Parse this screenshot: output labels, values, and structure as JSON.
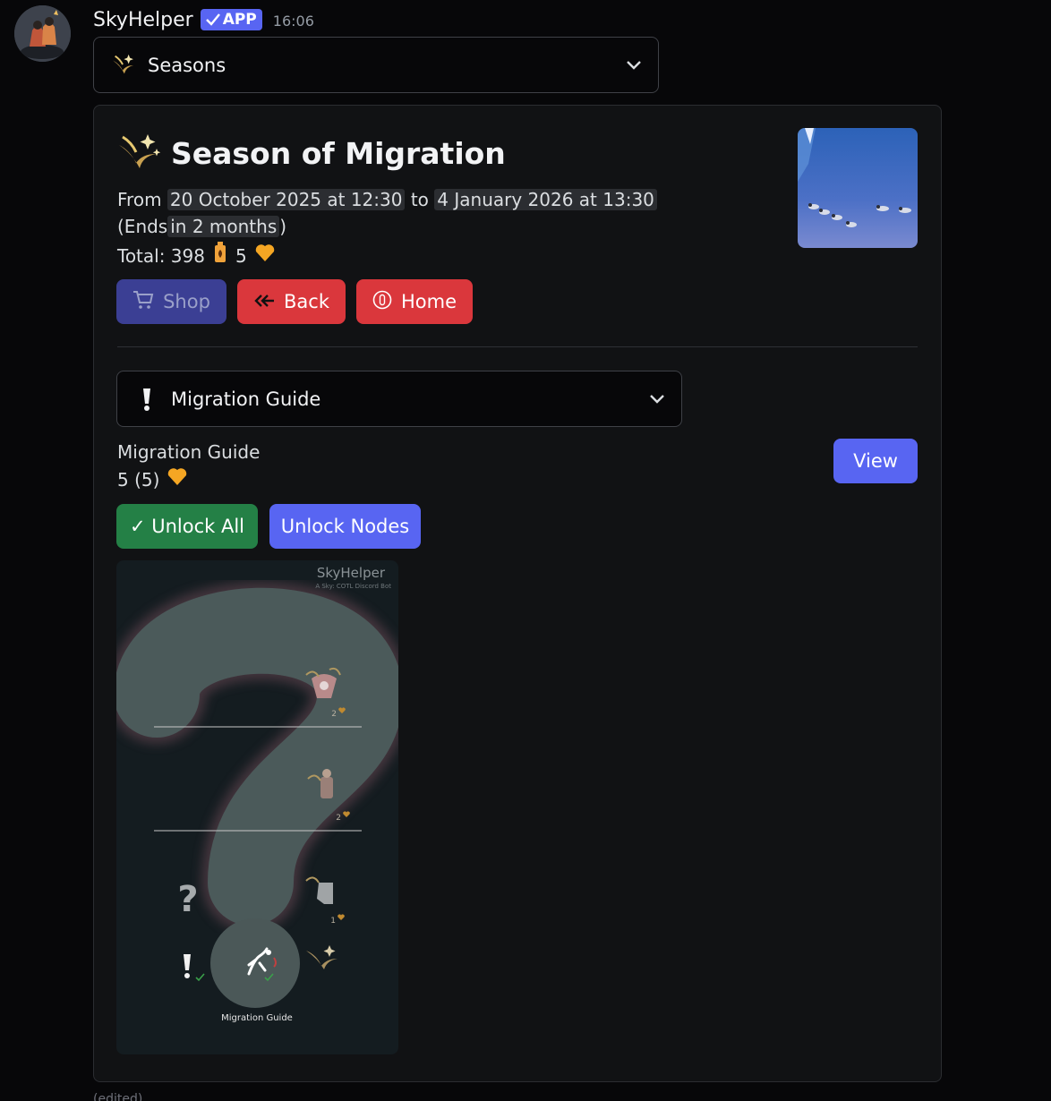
{
  "message": {
    "author": "SkyHelper",
    "badge": "APP",
    "time": "16:06",
    "avatar_icon": "avatar-image",
    "edited": "(edited)"
  },
  "seasons_select": {
    "label": "Seasons",
    "icon": "season-icon"
  },
  "embed": {
    "title": "Season of Migration",
    "date_from_prefix": "From",
    "date_start": "20 October 2025 at 12:30",
    "date_to": "to",
    "date_end": "4 January 2026 at 13:30",
    "ends_prefix": "(Ends",
    "ends_relative": "in 2 months",
    "ends_suffix": ")",
    "total_label": "Total: 398",
    "total_hearts": "5",
    "colors": {
      "candle": "#f0a23a",
      "heart": "#f5a623",
      "accent": "#5865f2",
      "danger": "#da373c",
      "success": "#248046"
    }
  },
  "buttons": {
    "shop": "Shop",
    "back": "Back",
    "home": "Home",
    "view": "View",
    "unlock_all": "✓ Unlock All",
    "unlock_nodes": "Unlock Nodes"
  },
  "guide_select": {
    "label": "Migration Guide",
    "icon": "exclamation-icon"
  },
  "guide": {
    "name": "Migration Guide",
    "cost": "5 (5)"
  },
  "tree_image": {
    "watermark_title": "SkyHelper",
    "watermark_sub": "A Sky: COTL Discord Bot",
    "caption": "Migration Guide",
    "node_costs": [
      "2",
      "2",
      "1"
    ]
  }
}
